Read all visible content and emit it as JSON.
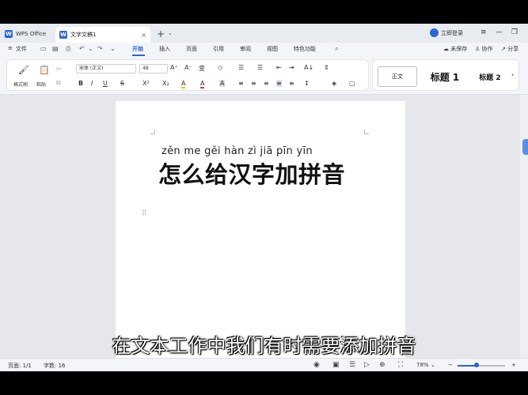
{
  "app": {
    "name": "WPS Office",
    "doc_tab": "文字文稿1",
    "tab_close": "×",
    "new_tab": "+",
    "new_tab_menu": "⌄",
    "login": "立即登录"
  },
  "window_controls": {
    "menu": "≡",
    "minimize": "—",
    "restore": "❐",
    "close": "✕"
  },
  "menubar": {
    "file": "文件",
    "file_menu_icon": "≡",
    "quick_icons": [
      "▭",
      "▤",
      "⎙",
      "↶",
      "⌄",
      "↷",
      "⌄"
    ],
    "tabs": [
      "开始",
      "插入",
      "页面",
      "引用",
      "审阅",
      "视图",
      "特色功能"
    ],
    "active_tab": "开始",
    "search_icon": "⌕",
    "right": {
      "unsaved": "未保存",
      "collab": "协作",
      "share": "分享"
    }
  },
  "toolbar": {
    "format_painter": "格式刷",
    "paste": "粘贴",
    "font_name": "宋体 (正文)",
    "font_size": "48",
    "grow": "A⁺",
    "shrink": "A⁻",
    "pinyin": "变",
    "clear": "◇",
    "bold": "B",
    "italic": "I",
    "underline": "U",
    "strike": "S",
    "superscript": "X²",
    "subscript": "X₂",
    "highlight": "A",
    "font_color": "A",
    "char_shade": "A",
    "bullets": "☰",
    "numbering": "☰",
    "indent_dec": "⇤",
    "indent_inc": "⇥",
    "sort": "A↓",
    "spacing": "⇕",
    "align_left": "≡",
    "align_center": "≡",
    "align_right": "≡",
    "justify": "≡",
    "distribute": "≡",
    "line_spacing": "↕",
    "shading": "◈",
    "borders": "▢",
    "styles": {
      "normal": "正文",
      "heading1": "标题 1",
      "heading2": "标题 2"
    },
    "more": "›"
  },
  "document": {
    "pinyin": "zěn me gěi hàn zì jiā pīn yīn",
    "title": "怎么给汉字加拼音",
    "drag_handle": "⠿"
  },
  "subtitle": "在文本工作中我们有时需要添加拼音",
  "status": {
    "page": "页面: 1/1",
    "words": "字数: 16",
    "zoom": "78%",
    "zoom_minus": "−",
    "zoom_plus": "+",
    "zoom_fraction": 0.4,
    "view_icons": [
      "◉",
      "▣",
      "☰",
      "▷",
      "⊕",
      "⛶"
    ]
  },
  "colors": {
    "accent": "#2b63d9",
    "canvas": "#e6e7ea",
    "chrome": "#f3f5f8",
    "page": "#ffffff"
  }
}
